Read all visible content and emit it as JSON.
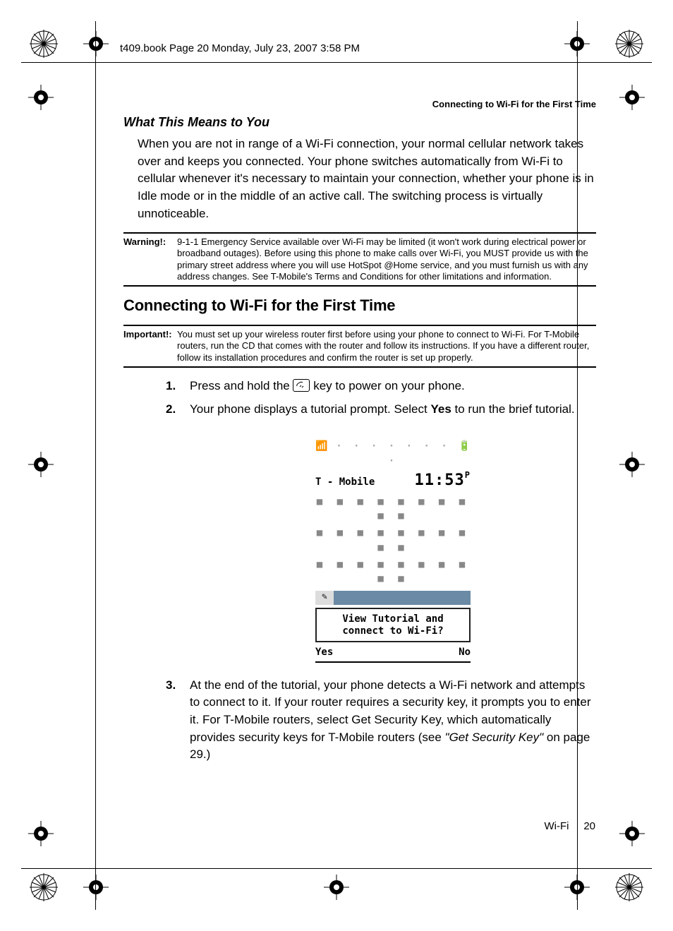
{
  "frame_header": "t409.book  Page 20  Monday, July 23, 2007  3:58 PM",
  "running_head": "Connecting to Wi-Fi for the First Time",
  "section1": {
    "heading": "What This Means to You",
    "para": "When you are not in range of a Wi-Fi connection, your normal cellular network takes over and keeps you connected. Your phone switches automatically from Wi-Fi to cellular whenever it's necessary to maintain your connection, whether your phone is in Idle mode or in the middle of an active call. The switching process is virtually unnoticeable."
  },
  "warning": {
    "label": "Warning!:",
    "text": "9-1-1 Emergency Service available over Wi-Fi may be limited (it won't work during electrical power or broadband outages). Before using this phone to make calls over Wi-Fi, you MUST provide us with the primary street address where you will use HotSpot @Home service, and you must furnish us with any address changes. See T-Mobile's Terms and Conditions for other limitations and information."
  },
  "section2": {
    "heading": "Connecting to Wi-Fi for the First Time"
  },
  "important": {
    "label": "Important!:",
    "text": "You must set up your wireless router first before using your phone to connect to Wi-Fi. For T-Mobile routers, run the CD that comes with the router and follow its instructions. If you have a different router, follow its installation procedures and confirm the router is set up properly."
  },
  "steps": [
    {
      "a": "Press and hold the ",
      "b": " key to power on your phone."
    },
    {
      "a": "Your phone displays a tutorial prompt. Select ",
      "bold": "Yes",
      "b": " to run the brief tutorial."
    },
    {
      "a": "At the end of the tutorial, your phone detects a Wi-Fi network and attempts to connect to it. If your router requires a security key, it prompts you to enter it. For T-Mobile routers, select Get Security Key, which automatically provides security keys for T-Mobile routers (see ",
      "ital": "\"Get Security Key\"",
      "b": "  on page 29.)"
    }
  ],
  "phone": {
    "signal": "📶",
    "battery": "🔋",
    "carrier": "T - Mobile",
    "time": "11:53",
    "ampm": "P",
    "prompt_line1": "View Tutorial and",
    "prompt_line2": "connect to Wi-Fi?",
    "soft_left": "Yes",
    "soft_right": "No"
  },
  "footer": {
    "section": "Wi-Fi",
    "page": "20"
  }
}
